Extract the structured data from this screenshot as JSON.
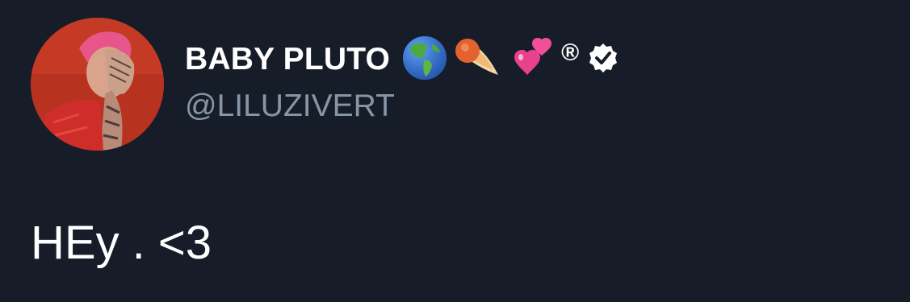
{
  "tweet": {
    "display_name": "BABY PLUTO",
    "name_emojis": [
      "globe-americas-icon",
      "comet-icon",
      "two-hearts-icon"
    ],
    "registered_mark": "®",
    "verified": true,
    "handle": "@LILUZIVERT",
    "text": "HEy . <3"
  },
  "colors": {
    "background": "#161d29",
    "name": "#ffffff",
    "handle": "#8795a6",
    "avatar_bg": "#b8311f"
  }
}
